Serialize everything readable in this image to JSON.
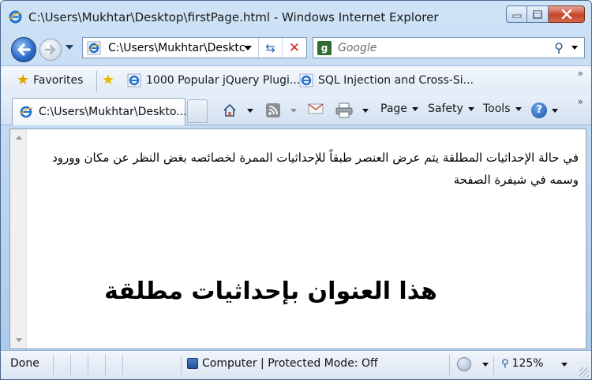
{
  "window": {
    "title": "C:\\Users\\Mukhtar\\Desktop\\firstPage.html - Windows Internet Explorer"
  },
  "nav": {
    "address": "C:\\Users\\Mukhtar\\Desktc",
    "search_placeholder": "Google"
  },
  "favorites": {
    "label": "Favorites",
    "items": [
      {
        "label": "1000 Popular jQuery Plugi..."
      },
      {
        "label": "SQL Injection and Cross-Si..."
      }
    ]
  },
  "tabs": [
    {
      "label": "C:\\Users\\Mukhtar\\Deskto..."
    }
  ],
  "commands": {
    "page": "Page",
    "safety": "Safety",
    "tools": "Tools",
    "help": "?"
  },
  "content": {
    "paragraph": "في حالة الإحداثيات المطلقة يتم عرض العنصر طبقاً للإحداثيات الممرة لخصائصه بغض النظر عن مكان وورود وسمه في شيفرة الصفحة",
    "heading": "هذا العنوان بإحداثيات مطلقة"
  },
  "status": {
    "text": "Done",
    "zone": "Computer | Protected Mode: Off",
    "zoom": "125%"
  },
  "colors": {
    "accent": "#2a67c6",
    "close_button": "#c7452a"
  }
}
